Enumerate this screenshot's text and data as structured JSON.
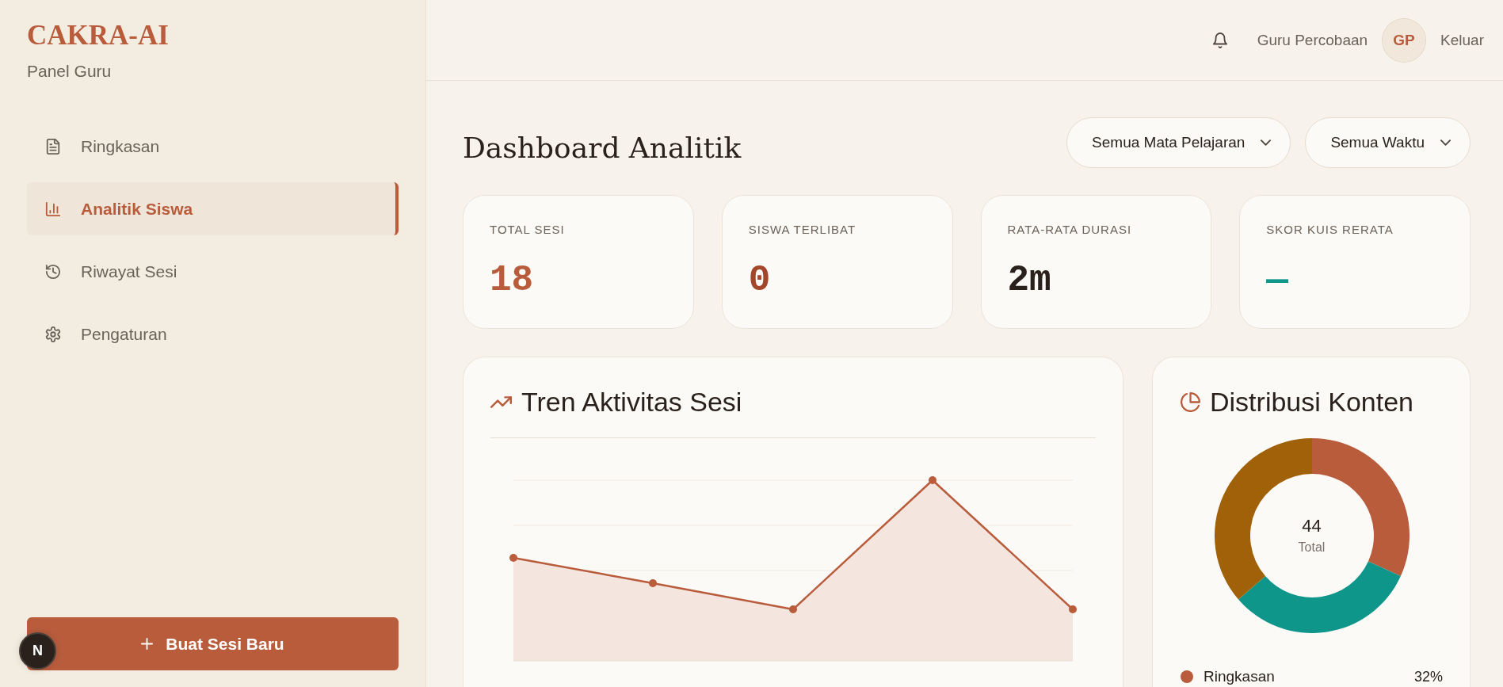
{
  "sidebar": {
    "logo": "CAKRA-AI",
    "subtitle": "Panel Guru",
    "items": [
      {
        "label": "Ringkasan",
        "selected": false
      },
      {
        "label": "Analitik Siswa",
        "selected": true
      },
      {
        "label": "Riwayat Sesi",
        "selected": false
      },
      {
        "label": "Pengaturan",
        "selected": false
      }
    ],
    "new_session_button": "Buat Sesi Baru"
  },
  "floating_button": {
    "label": "N"
  },
  "header": {
    "user_name": "Guru Percobaan",
    "avatar_initials": "GP",
    "logout": "Keluar"
  },
  "page_title": "Dashboard Analitik",
  "filters": [
    {
      "value": "Semua Mata Pelajaran"
    },
    {
      "value": "Semua Waktu"
    }
  ],
  "stats": [
    {
      "label": "TOTAL SESI",
      "value": "18",
      "color": "#b85c3c"
    },
    {
      "label": "SISWA TERLIBAT",
      "value": "0",
      "color": "#a3472b"
    },
    {
      "label": "RATA-RATA DURASI",
      "value": "2m",
      "color": "#2a211c"
    },
    {
      "label": "SKOR KUIS RERATA",
      "value": "—",
      "color": "#0f968a"
    }
  ],
  "activity_card": {
    "title": "Tren Aktivitas Sesi"
  },
  "distribution_card": {
    "title": "Distribusi Konten",
    "total": "44",
    "total_label": "Total",
    "legend": [
      {
        "label": "Ringkasan",
        "value": "32%",
        "color": "#b85c3c"
      }
    ]
  }
}
